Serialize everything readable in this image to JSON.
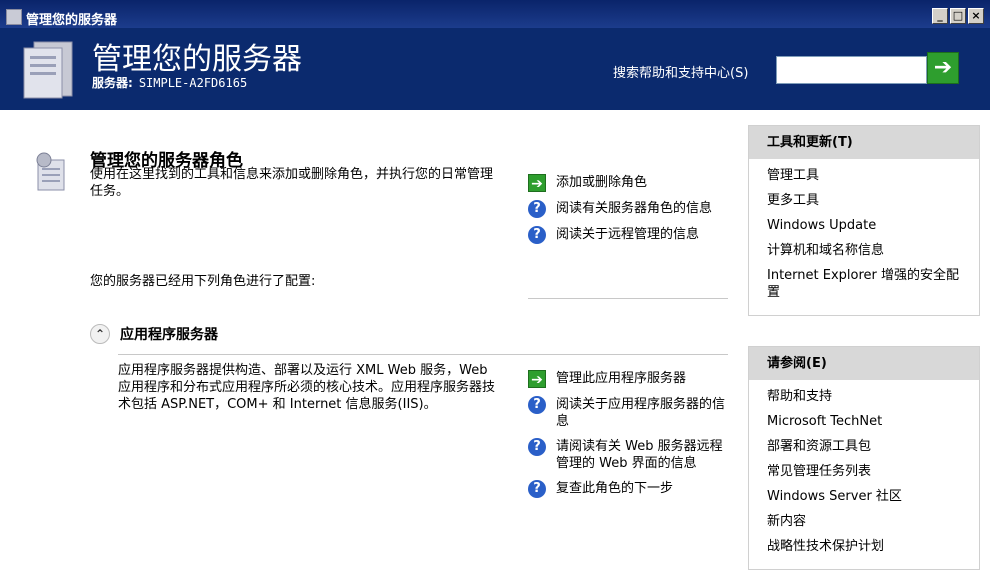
{
  "window": {
    "title": "管理您的服务器",
    "min_icon": "_",
    "max_icon": "□",
    "close_icon": "×"
  },
  "header": {
    "title": "管理您的服务器",
    "server_label": "服务器:",
    "server_name": "SIMPLE-A2FD6165",
    "search_label": "搜索帮助和支持中心(S)",
    "search_value": "",
    "go_icon": "arrow-right-icon"
  },
  "main": {
    "title": "管理您的服务器角色",
    "description": "使用在这里找到的工具和信息来添加或删除角色，并执行您的日常管理任务。",
    "configured_text": "您的服务器已经用下列角色进行了配置:",
    "actions": [
      {
        "icon": "arrow",
        "label": "添加或删除角色"
      },
      {
        "icon": "help",
        "label": "阅读有关服务器角色的信息"
      },
      {
        "icon": "help",
        "label": "阅读关于远程管理的信息"
      }
    ]
  },
  "role": {
    "title": "应用程序服务器",
    "collapse_glyph": "⌃",
    "description": "应用程序服务器提供构造、部署以及运行 XML Web 服务，Web 应用程序和分布式应用程序所必须的核心技术。应用程序服务器技术包括 ASP.NET，COM+ 和 Internet 信息服务(IIS)。",
    "actions": [
      {
        "icon": "arrow",
        "label": "管理此应用程序服务器"
      },
      {
        "icon": "help",
        "label": "阅读关于应用程序服务器的信息"
      },
      {
        "icon": "help",
        "label": "请阅读有关 Web 服务器远程管理的 Web 界面的信息"
      },
      {
        "icon": "help",
        "label": "复查此角色的下一步"
      }
    ]
  },
  "sidebar": {
    "tools": {
      "title": "工具和更新(T)",
      "items": [
        "管理工具",
        "更多工具",
        "Windows Update",
        "计算机和域名称信息",
        "Internet Explorer 增强的安全配置"
      ]
    },
    "see_also": {
      "title": "请参阅(E)",
      "items": [
        "帮助和支持",
        "Microsoft TechNet",
        "部署和资源工具包",
        "常见管理任务列表",
        "Windows Server 社区",
        "新内容",
        "战略性技术保护计划"
      ]
    }
  }
}
